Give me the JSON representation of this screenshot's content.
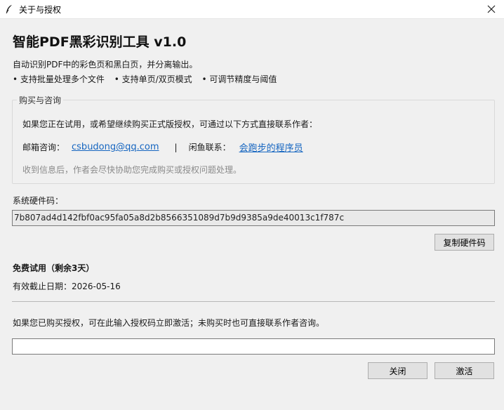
{
  "window": {
    "title": "关于与授权",
    "app_icon": "feather-icon",
    "close_icon": "close-icon"
  },
  "header": {
    "app_title": "智能PDF黑彩识别工具 v1.0",
    "description": "自动识别PDF中的彩色页和黑白页，并分离输出。",
    "features": [
      "• 支持批量处理多个文件",
      "• 支持单页/双页模式",
      "• 可调节精度与阈值"
    ]
  },
  "purchase": {
    "legend": "购买与咨询",
    "intro": "如果您正在试用，或希望继续购买正式版授权，可通过以下方式直接联系作者：",
    "email_label": "邮箱咨询：",
    "email_link": "csbudong@qq.com",
    "separator": "|",
    "xianyu_label": "闲鱼联系：",
    "xianyu_link": "会跑步的程序员",
    "note": "收到信息后，作者会尽快协助您完成购买或授权问题处理。",
    "link_color": "#1565c0"
  },
  "hardware": {
    "label": "系统硬件码：",
    "code": "7b807ad4d142fbf0ac95fa05a8d2b8566351089d7b9d9385a9de40013c1f787c",
    "copy_button": "复制硬件码"
  },
  "trial": {
    "title": "免费试用（剩余3天）",
    "expiry": "有效截止日期：2026-05-16"
  },
  "activation": {
    "hint": "如果您已购买授权，可在此输入授权码立即激活；未购买时也可直接联系作者咨询。",
    "input_value": "",
    "close_button": "关闭",
    "activate_button": "激活"
  }
}
